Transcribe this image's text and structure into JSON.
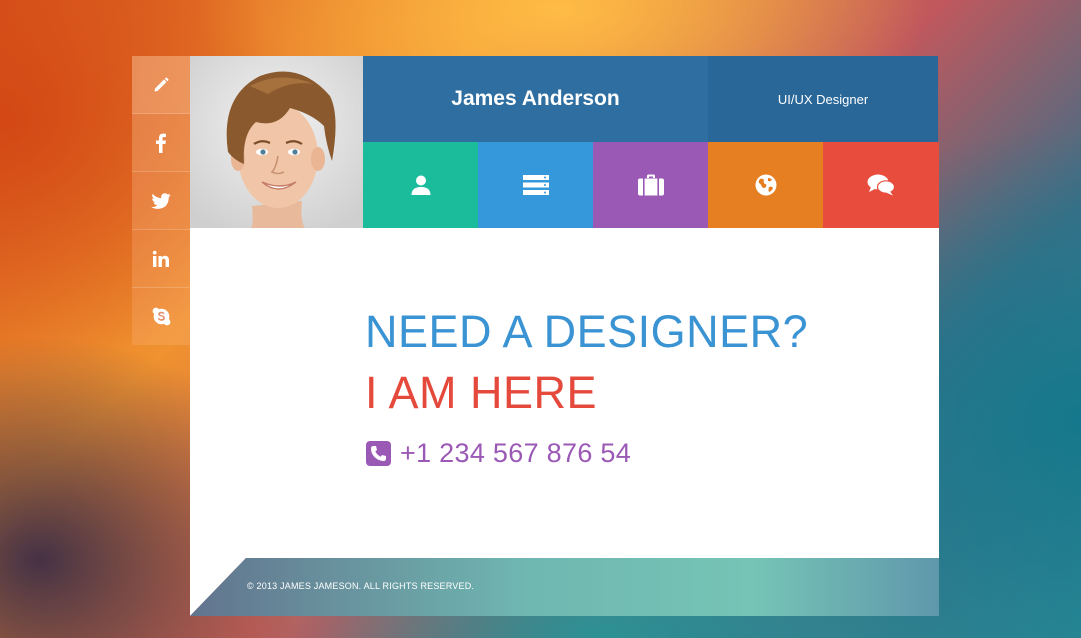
{
  "profile": {
    "name": "James Anderson",
    "title": "UI/UX Designer"
  },
  "social": [
    {
      "icon": "pencil-icon",
      "name": "edit"
    },
    {
      "icon": "facebook-icon",
      "name": "facebook"
    },
    {
      "icon": "twitter-icon",
      "name": "twitter"
    },
    {
      "icon": "linkedin-icon",
      "name": "linkedin"
    },
    {
      "icon": "skype-icon",
      "name": "skype"
    }
  ],
  "nav": [
    {
      "icon": "user-icon",
      "color": "#1abc9c"
    },
    {
      "icon": "list-icon",
      "color": "#3498db"
    },
    {
      "icon": "briefcase-icon",
      "color": "#9b59b6"
    },
    {
      "icon": "globe-icon",
      "color": "#e67e22"
    },
    {
      "icon": "chat-icon",
      "color": "#e74c3c"
    }
  ],
  "hero": {
    "line1": "NEED A DESIGNER?",
    "line2": "I AM HERE",
    "phone": "+1 234 567 876 54"
  },
  "footer": {
    "copyright": "© 2013 JAMES JAMESON. ALL RIGHTS RESERVED."
  },
  "colors": {
    "header_dark_blue": "#2e6ea0",
    "headline_blue": "#3a93d3",
    "headline_red": "#e4493b",
    "phone_purple": "#9b59b6"
  }
}
